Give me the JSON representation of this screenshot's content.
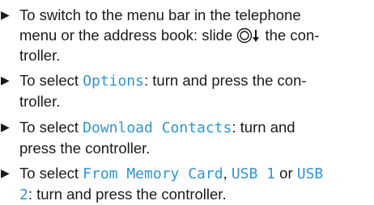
{
  "bullet": "▶",
  "steps": [
    {
      "l1": "To switch to the menu bar in the telephone",
      "l2a": "menu or the address book: slide",
      "l2b": "the con-",
      "l3": "troller."
    },
    {
      "pre": "To select",
      "ui": "Options",
      "post": ": turn and press the con-",
      "l2": "troller."
    },
    {
      "pre": "To select",
      "ui": "Download Contacts",
      "post": ": turn and",
      "l2": "press the controller."
    },
    {
      "pre": "To select",
      "ui1": "From Memory Card",
      "sep1": ",",
      "ui2": "USB 1",
      "sep2": "or",
      "ui3a": "USB",
      "ui3b": "2",
      "post": ": turn and press the controller."
    }
  ],
  "accent_color": "#2f95d0",
  "icon": "controller-slide-down-icon"
}
